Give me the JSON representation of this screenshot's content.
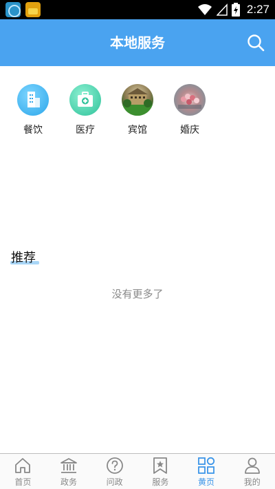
{
  "status_bar": {
    "time": "2:27"
  },
  "header": {
    "title": "本地服务"
  },
  "categories": [
    {
      "label": "餐饮",
      "icon": "building-icon"
    },
    {
      "label": "医疗",
      "icon": "medical-kit-icon"
    },
    {
      "label": "宾馆",
      "icon": "hotel-photo"
    },
    {
      "label": "婚庆",
      "icon": "wedding-photo"
    }
  ],
  "section": {
    "title": "推荐",
    "empty_text": "没有更多了"
  },
  "bottom_nav": {
    "items": [
      {
        "label": "首页",
        "icon": "home-icon"
      },
      {
        "label": "政务",
        "icon": "government-building-icon"
      },
      {
        "label": "问政",
        "icon": "question-icon"
      },
      {
        "label": "服务",
        "icon": "service-bookmark-icon"
      },
      {
        "label": "黄页",
        "icon": "grid-apps-icon",
        "active": true
      },
      {
        "label": "我的",
        "icon": "user-icon"
      }
    ]
  },
  "colors": {
    "header": "#4aa3f0",
    "active_tab": "#3b95e8",
    "inactive_tab": "#888888"
  }
}
